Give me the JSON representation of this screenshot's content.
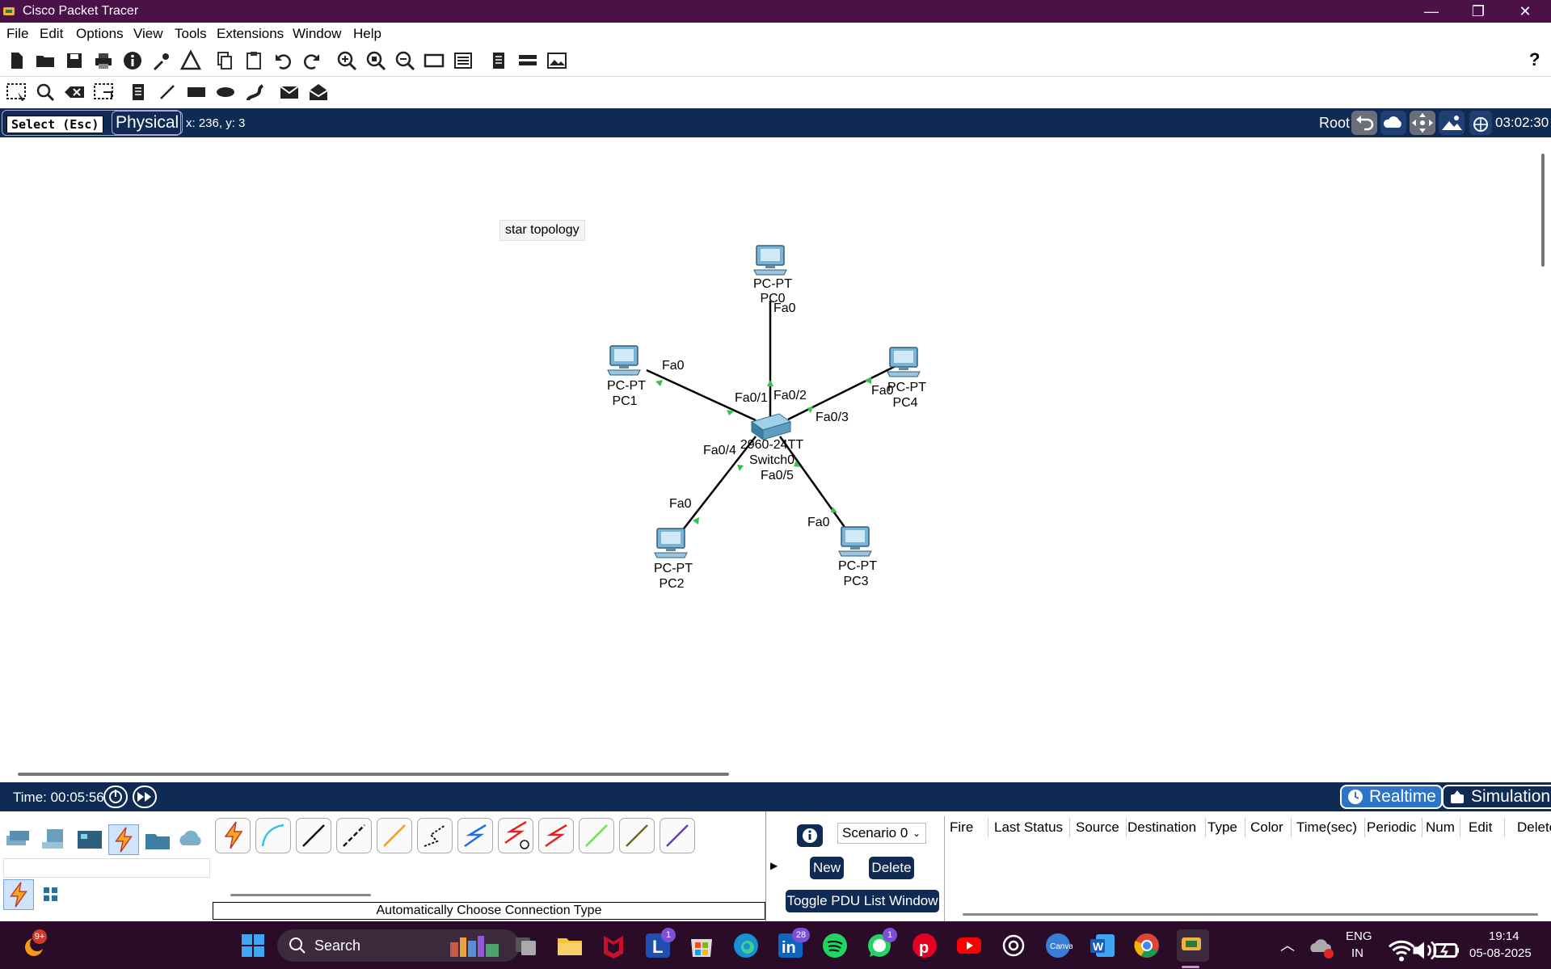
{
  "window": {
    "title": "Cisco Packet Tracer",
    "minimize": "—",
    "restore": "❐",
    "close": "✕"
  },
  "menu": [
    "File",
    "Edit",
    "Options",
    "View",
    "Tools",
    "Extensions",
    "Window",
    "Help"
  ],
  "toolbar": {
    "primary": [
      "new-file-icon",
      "open-file-icon",
      "save-icon",
      "print-icon",
      "info-icon",
      "activity-wizard-icon",
      "custom-device-icon",
      "copy-icon",
      "paste-icon",
      "undo-icon",
      "redo-icon",
      "zoom-in-icon",
      "zoom-reset-icon",
      "zoom-out-icon",
      "drawing-palette-icon",
      "device-template-icon",
      "viewport-icon",
      "ipc-icon",
      "screenshot-icon"
    ],
    "help": "?",
    "secondary": [
      "select-icon",
      "inspect-icon",
      "delete-icon",
      "resize-icon",
      "note-icon",
      "line-icon",
      "rectangle-icon",
      "ellipse-icon",
      "freeform-icon",
      "add-simple-pdu-icon",
      "add-complex-pdu-icon"
    ]
  },
  "workspace": {
    "select_label": "Select (Esc)",
    "physical_tab": "Physical",
    "coords": "x: 236, y: 3",
    "root_label": "Root",
    "clock": "03:02:30"
  },
  "note": {
    "text": "star topology"
  },
  "network": {
    "switch": {
      "model": "2960-24TT",
      "name": "Switch0"
    },
    "pcs": [
      {
        "model": "PC-PT",
        "name": "PC0",
        "pc_port": "Fa0",
        "switch_port": "Fa0/2"
      },
      {
        "model": "PC-PT",
        "name": "PC1",
        "pc_port": "Fa0",
        "switch_port": "Fa0/1"
      },
      {
        "model": "PC-PT",
        "name": "PC4",
        "pc_port": "Fa0",
        "switch_port": "Fa0/3"
      },
      {
        "model": "PC-PT",
        "name": "PC2",
        "pc_port": "Fa0",
        "switch_port": "Fa0/4"
      },
      {
        "model": "PC-PT",
        "name": "PC3",
        "pc_port": "Fa0",
        "switch_port": "Fa0/5"
      }
    ],
    "link_color": "#000000",
    "port_status_color": "#35c24a"
  },
  "simulation": {
    "time_label": "Time: 00:05:56",
    "realtime": "Realtime",
    "simulation": "Simulation"
  },
  "bottom_panel": {
    "device_categories": [
      "network-devices-icon",
      "end-devices-icon",
      "components-icon",
      "connections-icon",
      "miscellaneous-icon",
      "multiuser-icon"
    ],
    "connection_types": [
      "automatic",
      "console",
      "copper-straight",
      "copper-cross",
      "fiber",
      "phone",
      "coaxial",
      "serial-dce",
      "serial-dte",
      "octal",
      "iot-custom",
      "usb"
    ],
    "auto_label": "Automatically Choose Connection Type",
    "scenario": "Scenario 0",
    "new": "New",
    "delete": "Delete",
    "toggle_pdu": "Toggle PDU List Window",
    "pdu_columns": [
      "Fire",
      "Last Status",
      "Source",
      "Destination",
      "Type",
      "Color",
      "Time(sec)",
      "Periodic",
      "Num",
      "Edit",
      "Delete"
    ]
  },
  "taskbar": {
    "search": "Search",
    "badge_main": "9+",
    "badge_linkedin_l": "1",
    "badge_linkedin": "28",
    "badge_whatsapp": "1",
    "lang": "ENG",
    "region": "IN",
    "time": "19:14",
    "date": "05-08-2025"
  }
}
